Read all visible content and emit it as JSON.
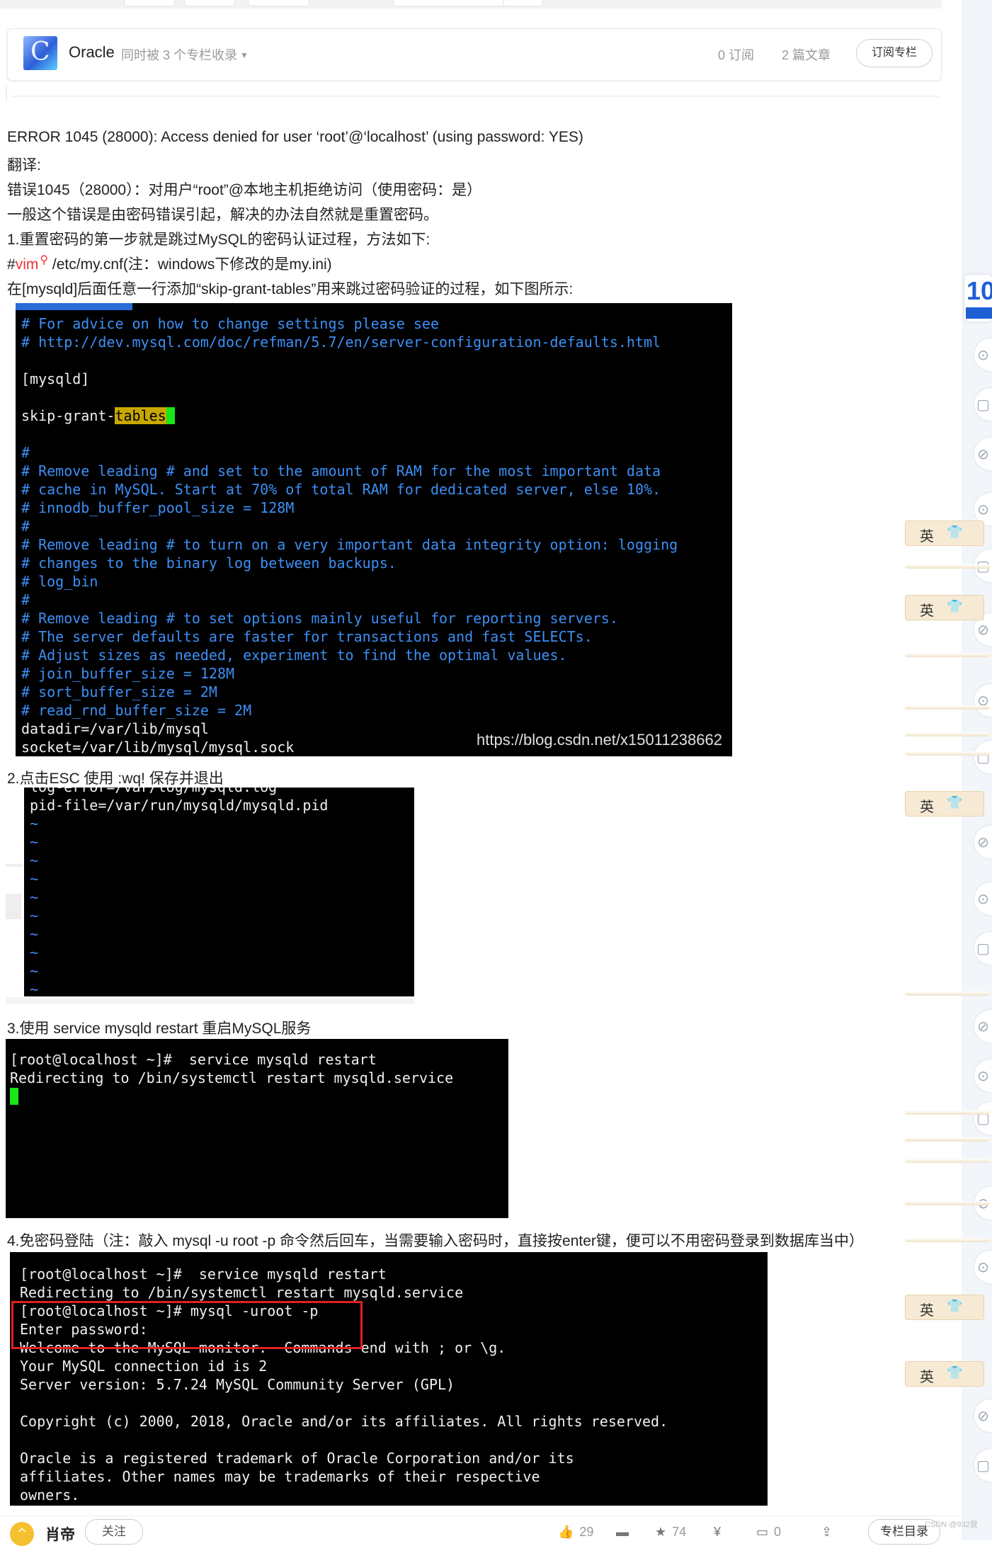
{
  "column_card": {
    "name": "Oracle",
    "included_text": "同时被 3 个专栏收录",
    "subscribers": "0 订阅",
    "articles": "2 篇文章",
    "subscribe_button": "订阅专栏"
  },
  "article": {
    "p1": "ERROR 1045 (28000): Access denied for user ‘root’@‘localhost’ (using password: YES)",
    "p2": "翻译:",
    "p3": "错误1045（28000）：对用户“root”@本地主机拒绝访问（使用密码：是）",
    "p4": "一般这个错误是由密码错误引起，解决的办法自然就是重置密码。",
    "p5": "1.重置密码的第一步就是跳过MySQL的密码认证过程，方法如下:",
    "p6_hash": "#",
    "p6_link": "vim",
    "p6_rest": " /etc/my.cnf(注：windows下修改的是my.ini)",
    "p7": "在[mysqld]后面任意一行添加“skip-grant-tables”用来跳过密码验证的过程，如下图所示:",
    "p8": "2.点击ESC 使用 :wq!  保存并退出",
    "p9": "3.使用 service mysqld restart 重启MySQL服务",
    "p10": "4.免密码登陆（注：敲入 mysql -u root -p 命令然后回车，当需要输入密码时，直接按enter键，便可以不用密码登录到数据库当中）"
  },
  "terminal1": {
    "l1": "# For advice on how to change settings please see",
    "l2": "# http://dev.mysql.com/doc/refman/5.7/en/server-configuration-defaults.html",
    "l3": "[mysqld]",
    "l4a": "skip-grant-",
    "l4b": "tables",
    "l5": "#",
    "l6": "# Remove leading # and set to the amount of RAM for the most important data",
    "l7": "# cache in MySQL. Start at 70% of total RAM for dedicated server, else 10%.",
    "l8": "# innodb_buffer_pool_size = 128M",
    "l9": "#",
    "l10": "# Remove leading # to turn on a very important data integrity option: logging",
    "l11": "# changes to the binary log between backups.",
    "l12": "# log_bin",
    "l13": "#",
    "l14": "# Remove leading # to set options mainly useful for reporting servers.",
    "l15": "# The server defaults are faster for transactions and fast SELECTs.",
    "l16": "# Adjust sizes as needed, experiment to find the optimal values.",
    "l17": "# join_buffer_size = 128M",
    "l18": "# sort_buffer_size = 2M",
    "l19": "# read_rnd_buffer_size = 2M",
    "l20": "datadir=/var/lib/mysql",
    "l21": "socket=/var/lib/mysql/mysql.sock",
    "watermark": "https://blog.csdn.net/x15011238662"
  },
  "terminal2": {
    "l0": "log-error=/var/log/mysqld.log",
    "l1": "pid-file=/var/run/mysqld/mysqld.pid",
    "tilde": "~"
  },
  "terminal3": {
    "l1": "[root@localhost ~]#  service mysqld restart",
    "l2": "Redirecting to /bin/systemctl restart mysqld.service"
  },
  "terminal4": {
    "l1": "[root@localhost ~]#  service mysqld restart",
    "l2": "Redirecting to /bin/systemctl restart mysqld.service",
    "l3": "[root@localhost ~]# mysql -uroot -p",
    "l4": "Enter password:",
    "l5": "Welcome to the MySQL monitor.  Commands end with ; or \\g.",
    "l6": "Your MySQL connection id is 2",
    "l7": "Server version: 5.7.24 MySQL Community Server (GPL)",
    "l8": "Copyright (c) 2000, 2018, Oracle and/or its affiliates. All rights reserved.",
    "l9": "Oracle is a registered trademark of Oracle Corporation and/or its",
    "l10": "affiliates. Other names may be trademarks of their respective",
    "l11": "owners."
  },
  "ime": {
    "label": "英",
    "icon": "shirt-icon"
  },
  "sidebar": {
    "badge": "10"
  },
  "bottom_bar": {
    "author": "肖帝",
    "follow": "关注",
    "likes": "29",
    "favorites": "74",
    "comments": "0",
    "column_dir": "专栏目录",
    "csdn": "CSDN @932我"
  }
}
